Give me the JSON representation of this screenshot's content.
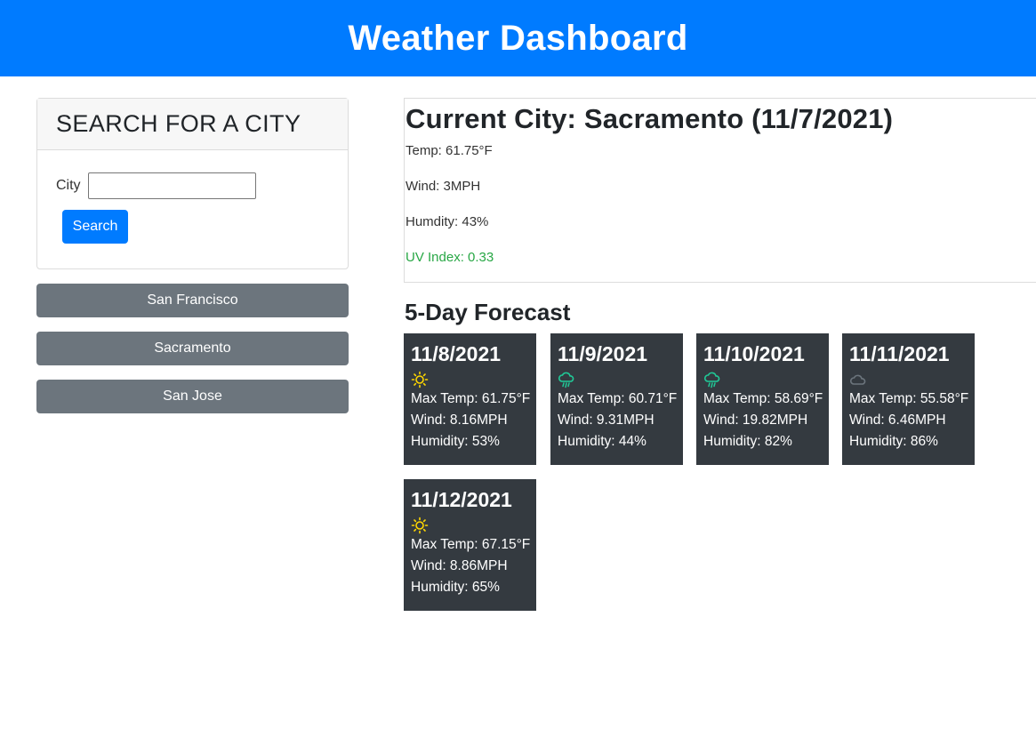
{
  "header": {
    "title": "Weather Dashboard"
  },
  "search": {
    "title": "SEARCH FOR A CITY",
    "city_label": "City",
    "city_value": "",
    "search_button": "Search"
  },
  "history": [
    "San Francisco",
    "Sacramento",
    "San Jose"
  ],
  "current": {
    "title": "Current City: Sacramento (11/7/2021)",
    "temp": "Temp: 61.75°F",
    "wind": "Wind: 3MPH",
    "humidity": "Humdity: 43%",
    "uv": "UV Index: 0.33",
    "uv_color": "#28a745"
  },
  "forecast": {
    "title": "5-Day Forecast",
    "days": [
      {
        "date": "11/8/2021",
        "icon": "sun-icon",
        "max_temp": "Max Temp: 61.75°F",
        "wind": "Wind: 8.16MPH",
        "humidity": "Humidity: 53%"
      },
      {
        "date": "11/9/2021",
        "icon": "rain-cloud-icon",
        "max_temp": "Max Temp: 60.71°F",
        "wind": "Wind: 9.31MPH",
        "humidity": "Humidity: 44%"
      },
      {
        "date": "11/10/2021",
        "icon": "rain-cloud-icon",
        "max_temp": "Max Temp: 58.69°F",
        "wind": "Wind: 19.82MPH",
        "humidity": "Humidity: 82%"
      },
      {
        "date": "11/11/2021",
        "icon": "cloud-icon",
        "max_temp": "Max Temp: 55.58°F",
        "wind": "Wind: 6.46MPH",
        "humidity": "Humidity: 86%"
      },
      {
        "date": "11/12/2021",
        "icon": "sun-icon",
        "max_temp": "Max Temp: 67.15°F",
        "wind": "Wind: 8.86MPH",
        "humidity": "Humidity: 65%"
      }
    ]
  },
  "colors": {
    "header": "#007bff",
    "history_button": "#6c757d",
    "forecast_card": "#343a40",
    "sun_icon": "#ffd700",
    "rain_icon": "#20c997",
    "cloud_icon": "#6c757d"
  }
}
